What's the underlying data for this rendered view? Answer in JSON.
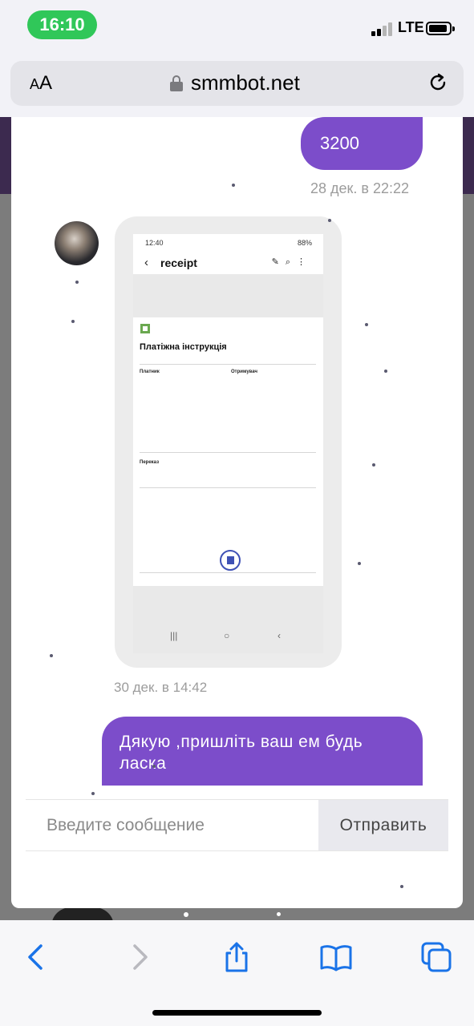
{
  "status_bar": {
    "time": "16:10",
    "network": "LTE",
    "battery_level": 0.8
  },
  "browser": {
    "text_size_label": "AA",
    "domain": "smmbot.net"
  },
  "chat": {
    "messages": [
      {
        "direction": "outgoing",
        "text": "3200",
        "time": "28 дек. в 22:22"
      },
      {
        "direction": "incoming",
        "type": "image",
        "time": "30 дек. в 14:42"
      },
      {
        "direction": "outgoing",
        "text": "Дякую ,пришліть ваш ем будь ласка"
      }
    ],
    "attachment": {
      "status_time": "12:40",
      "status_battery": "88%",
      "app_title": "receipt",
      "document_title": "Платіжна інструкція",
      "payer_heading": "Платник",
      "receiver_heading": "Отримувач",
      "transfer_heading": "Переказ"
    },
    "composer": {
      "placeholder": "Введите сообщение",
      "send_label": "Отправить"
    }
  }
}
